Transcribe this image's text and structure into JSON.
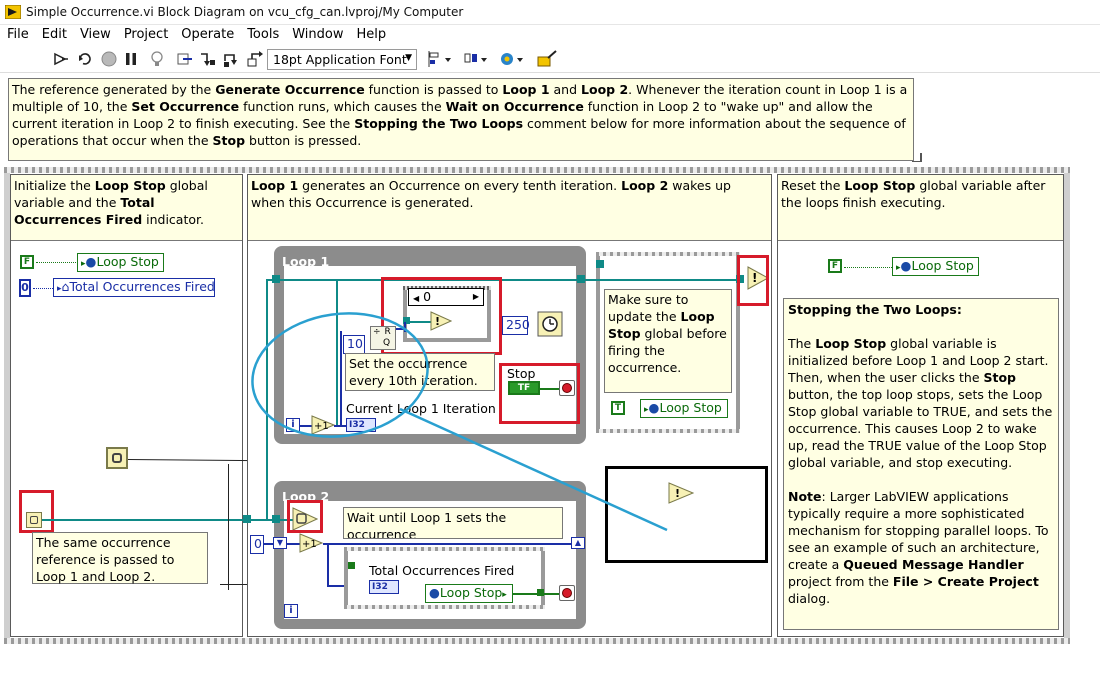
{
  "window": {
    "title": "Simple Occurrence.vi Block Diagram on vcu_cfg_can.lvproj/My Computer"
  },
  "menu": [
    "File",
    "Edit",
    "View",
    "Project",
    "Operate",
    "Tools",
    "Window",
    "Help"
  ],
  "toolbar": {
    "font_selector": "18pt Application Font",
    "icons": [
      "run-arrow-icon",
      "run-continuous-icon",
      "abort-icon",
      "pause-icon",
      "highlight-execution-icon",
      "retain-wire-values-icon",
      "step-into-icon",
      "step-over-icon",
      "step-out-icon",
      "align-objects-icon",
      "distribute-objects-icon",
      "reorder-icon",
      "clean-up-diagram-icon"
    ]
  },
  "top_comment": {
    "p1": "The reference generated by the ",
    "b1": "Generate Occurrence",
    "p2": " function is passed to ",
    "b2": "Loop 1",
    "p3": " and ",
    "b3": "Loop 2",
    "p4": ".  Whenever the iteration count in Loop 1 is a multiple of 10, the ",
    "b4": "Set Occurrence",
    "p5": " function runs, which causes the ",
    "b5": "Wait on Occurrence",
    "p6": " function in Loop 2 to \"wake up\" and allow the current iteration in Loop 2 to finish executing. See the ",
    "b6": "Stopping the Two Loops",
    "p7": " comment below for more information about the sequence of operations that occur when the ",
    "b7": "Stop",
    "p8": " button is pressed."
  },
  "frame1": {
    "c_p1": "Initialize the ",
    "c_b1": "Loop Stop",
    "c_p2": " global variable and the ",
    "c_b2": "Total Occurrences Fired",
    "c_p3": " indicator.",
    "const_false": "F",
    "global_loop_stop": "Loop Stop",
    "const_zero": "0",
    "local_total": "Total Occurrences Fired",
    "same_ref_comment": "The same occurrence reference is passed to Loop 1 and Loop 2."
  },
  "frame2": {
    "c_b1": "Loop 1",
    "c_p1": " generates an Occurrence on every tenth iteration. ",
    "c_b2": "Loop 2",
    "c_p2": " wakes up when this Occurrence is generated.",
    "loop1_label": "Loop 1",
    "case_selector": "0",
    "const_ten": "10",
    "const_250": "250",
    "set_comment": "Set the occurrence every 10th iteration.",
    "stop_label": "Stop",
    "stop_tf": "TF",
    "iteration_label": "Current Loop 1 Iteration",
    "i32": "I32",
    "update_comment_p1": "Make sure to update the ",
    "update_comment_b1": "Loop Stop",
    "update_comment_p2": " global before firing the occurrence.",
    "const_true": "T",
    "global_loop_stop": "Loop Stop",
    "loop2_label": "Loop 2",
    "wait_comment": "Wait until Loop 1 sets the occurrence",
    "total_label": "Total Occurrences Fired",
    "loop_stop_read": "Loop Stop",
    "const_zero": "0",
    "iter_i": "i"
  },
  "frame3": {
    "c_p1": "Reset the ",
    "c_b1": "Loop Stop",
    "c_p2": " global variable after the loops finish executing.",
    "const_false": "F",
    "global_loop_stop": "Loop Stop",
    "stopping_title": "Stopping the Two Loops:",
    "s_p1": "The ",
    "s_b1": "Loop Stop",
    "s_p2": " global variable is initialized before Loop 1 and Loop 2 start. Then, when the user clicks the ",
    "s_b2": "Stop",
    "s_p3": " button, the top loop stops, sets the Loop Stop global variable to TRUE, and sets the occurrence. This causes Loop 2 to wake up, read the TRUE value of the Loop Stop global variable, and stop executing.",
    "n_b1": "Note",
    "n_p1": ": Larger LabVIEW applications typically require a more sophisticated mechanism for stopping parallel loops. To see an example of such an architecture, create a ",
    "n_b2": "Queued Message Handler",
    "n_p2": " project from the ",
    "n_b3": "File > Create Project",
    "n_p3": " dialog."
  },
  "colors": {
    "annotation_red": "#d61b2a",
    "annotation_blue": "#2aa0d0",
    "comment_bg": "#ffffe3",
    "wire_teal": "#0f8a87",
    "bool_green": "#1a7a1a",
    "int_blue": "#1a2ea6"
  }
}
